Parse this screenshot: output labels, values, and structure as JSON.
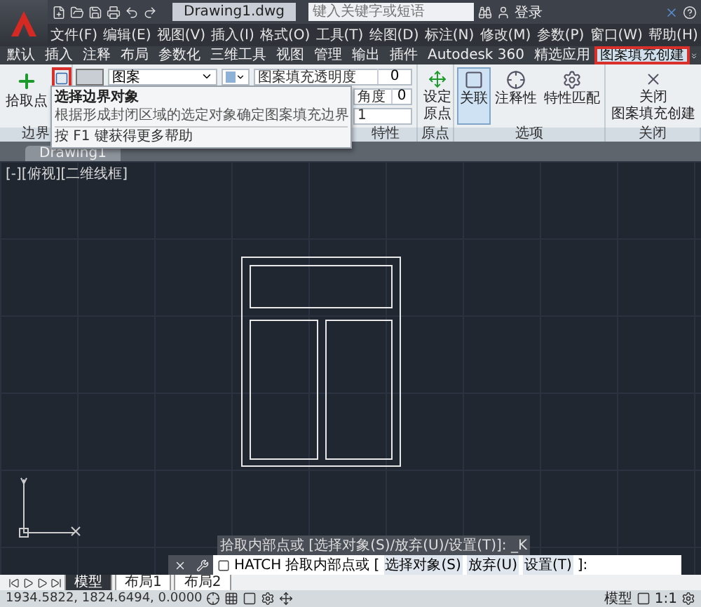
{
  "title_bar": {
    "title": "Drawing1.dwg",
    "search": {
      "placeholder": "键入关键字或短语"
    },
    "user": "登录"
  },
  "menu": [
    "文件(F)",
    "编辑(E)",
    "视图(V)",
    "插入(I)",
    "格式(O)",
    "工具(T)",
    "绘图(D)",
    "标注(N)",
    "修改(M)",
    "参数(P)",
    "窗口(W)",
    "帮助(H)"
  ],
  "ribbon_tabs": [
    {
      "label": "默认",
      "selected": false,
      "highlighted": false
    },
    {
      "label": "插入",
      "selected": false,
      "highlighted": false
    },
    {
      "label": "注释",
      "selected": false,
      "highlighted": false
    },
    {
      "label": "布局",
      "selected": false,
      "highlighted": false
    },
    {
      "label": "参数化",
      "selected": false,
      "highlighted": false
    },
    {
      "label": "三维工具",
      "selected": false,
      "highlighted": false
    },
    {
      "label": "视图",
      "selected": false,
      "highlighted": false
    },
    {
      "label": "管理",
      "selected": false,
      "highlighted": false
    },
    {
      "label": "输出",
      "selected": false,
      "highlighted": false
    },
    {
      "label": "插件",
      "selected": false,
      "highlighted": false
    },
    {
      "label": "Autodesk 360",
      "selected": false,
      "highlighted": false
    },
    {
      "label": "精选应用",
      "selected": false,
      "highlighted": false
    },
    {
      "label": "图案填充创建",
      "selected": true,
      "highlighted": true
    }
  ],
  "ribbon": {
    "boundary": {
      "pick_point": "拾取点",
      "select_highlighted": true,
      "label": "边界"
    },
    "pattern": {
      "pattern": "图案",
      "transparency_label": "图案填充透明度",
      "transparency": "0",
      "angle_label": "角度",
      "angle": "0",
      "scale": "1",
      "label": "特性"
    },
    "origin": {
      "button": [
        "设定",
        "原点"
      ],
      "label": "原点"
    },
    "options": {
      "buttons": [
        {
          "label": "关联",
          "selected": true
        },
        {
          "label": "注释性",
          "selected": false
        },
        {
          "label": "特性匹配",
          "selected": false
        }
      ],
      "label": "选项"
    },
    "close": {
      "button": [
        "关闭",
        "图案填充创建"
      ],
      "label": "关闭"
    }
  },
  "tooltip": {
    "title": "选择边界对象",
    "description": "根据形成封闭区域的选定对象确定图案填充边界",
    "help": "按 F1 键获得更多帮助"
  },
  "document_tab": "Drawing1",
  "viewport_label": "[-][俯视][二维线框]",
  "command_history": "拾取内部点或 [选择对象(S)/放弃(U)/设置(T)]: _K",
  "command_line": {
    "command": "HATCH",
    "prompt": "拾取内部点或 [",
    "options": [
      "选择对象(S)",
      "放弃(U)",
      "设置(T)"
    ],
    "suffix": "]:"
  },
  "layout_tabs": [
    {
      "label": "模型",
      "selected": true
    },
    {
      "label": "布局1",
      "selected": false
    },
    {
      "label": "布局2",
      "selected": false
    }
  ],
  "status_bar": {
    "coordinates": "1934.5822, 1824.6494, 0.0000",
    "space": "模型",
    "scale": "1:1"
  }
}
